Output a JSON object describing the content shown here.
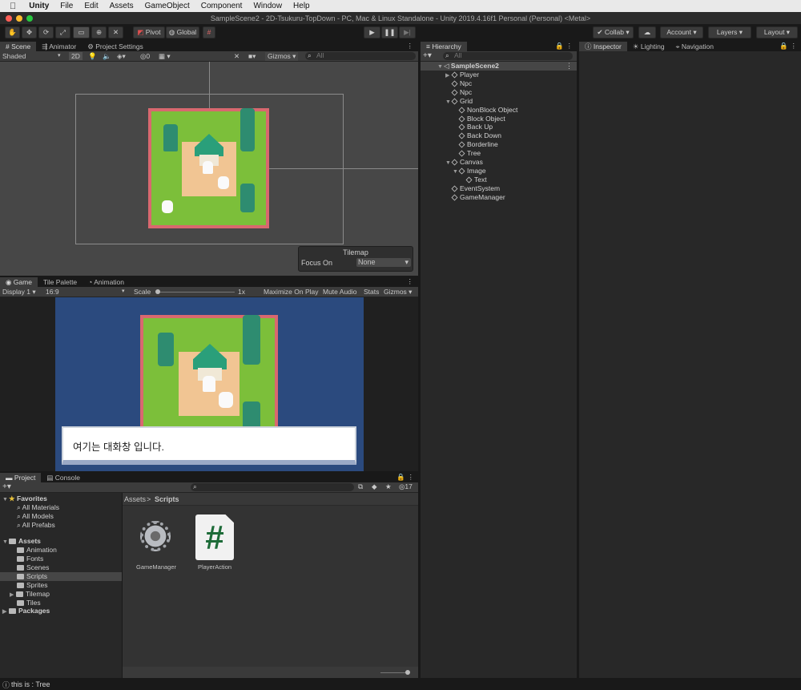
{
  "menubar": {
    "apple": "",
    "app_name": "Unity",
    "items": [
      "File",
      "Edit",
      "Assets",
      "GameObject",
      "Component",
      "Window",
      "Help"
    ]
  },
  "window": {
    "title": "SampleScene2 - 2D-Tsukuru-TopDown - PC, Mac & Linux Standalone - Unity 2019.4.16f1 Personal (Personal) <Metal>"
  },
  "toolbar": {
    "pivot": "Pivot",
    "global": "Global",
    "collab": "Collab",
    "account": "Account",
    "layers": "Layers",
    "layout": "Layout"
  },
  "scene": {
    "tabs": [
      "Scene",
      "Animator",
      "Project Settings"
    ],
    "shading": "Shaded",
    "mode2d": "2D",
    "hidden_count": "0",
    "gizmos": "Gizmos",
    "search_placeholder": "All",
    "overlay": {
      "title": "Tilemap",
      "label": "Focus On",
      "value": "None"
    }
  },
  "game": {
    "tabs": [
      "Game",
      "Tile Palette",
      "Animation"
    ],
    "display": "Display 1",
    "aspect": "16:9",
    "scale_label": "Scale",
    "scale_value": "1x",
    "maximize": "Maximize On Play",
    "mute": "Mute Audio",
    "stats": "Stats",
    "gizmos": "Gizmos",
    "dialog_text": "여기는 대화창 입니다."
  },
  "hierarchy": {
    "tab": "Hierarchy",
    "search_placeholder": "All",
    "scene_name": "SampleScene2",
    "items": [
      {
        "label": "Player",
        "depth": 1,
        "expand": "closed"
      },
      {
        "label": "Npc",
        "depth": 1,
        "expand": "none"
      },
      {
        "label": "Npc",
        "depth": 1,
        "expand": "none"
      },
      {
        "label": "Grid",
        "depth": 1,
        "expand": "open"
      },
      {
        "label": "NonBlock Object",
        "depth": 2,
        "expand": "none"
      },
      {
        "label": "Block Object",
        "depth": 2,
        "expand": "none"
      },
      {
        "label": "Back Up",
        "depth": 2,
        "expand": "none"
      },
      {
        "label": "Back Down",
        "depth": 2,
        "expand": "none"
      },
      {
        "label": "Borderline",
        "depth": 2,
        "expand": "none"
      },
      {
        "label": "Tree",
        "depth": 2,
        "expand": "none"
      },
      {
        "label": "Canvas",
        "depth": 1,
        "expand": "open"
      },
      {
        "label": "Image",
        "depth": 2,
        "expand": "open"
      },
      {
        "label": "Text",
        "depth": 3,
        "expand": "none"
      },
      {
        "label": "EventSystem",
        "depth": 1,
        "expand": "none"
      },
      {
        "label": "GameManager",
        "depth": 1,
        "expand": "none"
      }
    ]
  },
  "inspector": {
    "tabs": [
      "Inspector",
      "Lighting",
      "Navigation"
    ]
  },
  "project": {
    "tabs": [
      "Project",
      "Console"
    ],
    "count": "17",
    "breadcrumb": [
      "Assets",
      "Scripts"
    ],
    "favorites_label": "Favorites",
    "favorites": [
      "All Materials",
      "All Models",
      "All Prefabs"
    ],
    "assets_label": "Assets",
    "folders": [
      "Animation",
      "Fonts",
      "Scenes",
      "Scripts",
      "Sprites",
      "Tilemap",
      "Tiles"
    ],
    "packages_label": "Packages",
    "files": [
      {
        "name": "GameManager",
        "icon": "gear-icon"
      },
      {
        "name": "PlayerAction",
        "icon": "csharp-script-icon"
      }
    ]
  },
  "statusbar": {
    "text": "this is : Tree"
  }
}
